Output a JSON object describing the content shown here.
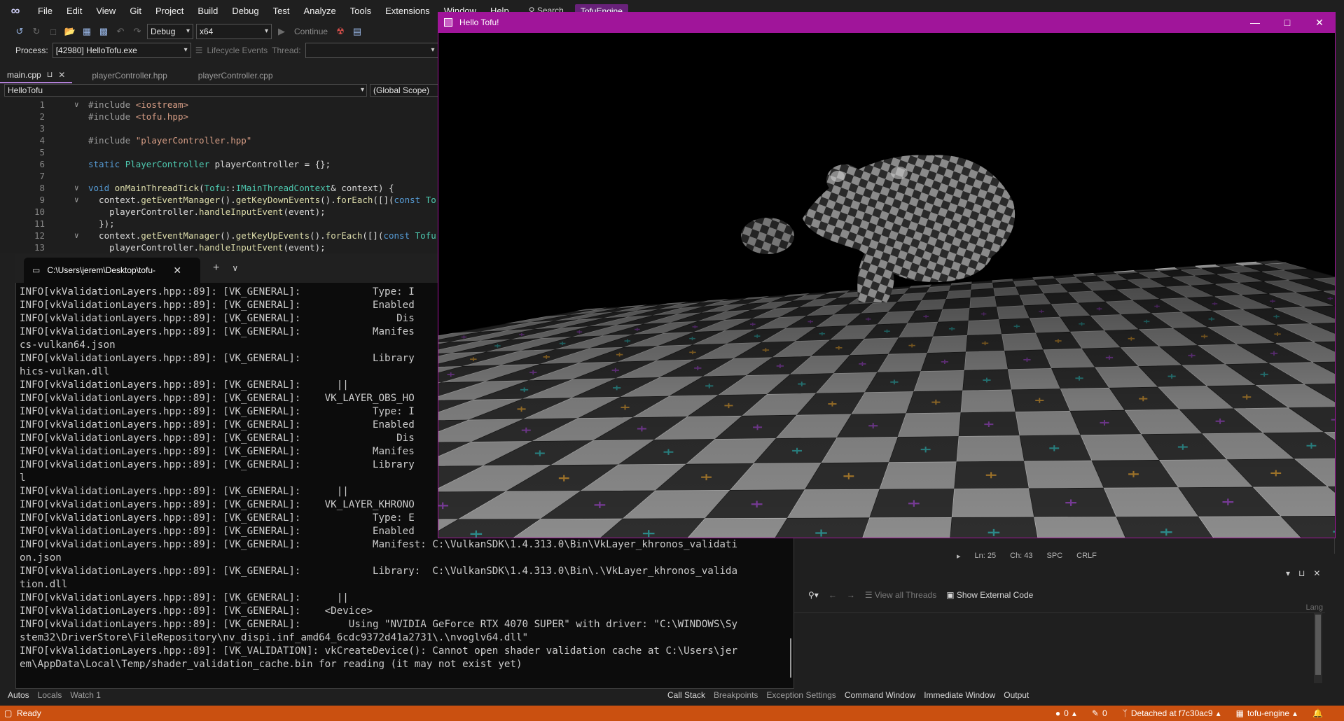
{
  "menubar": {
    "items": [
      "File",
      "Edit",
      "View",
      "Git",
      "Project",
      "Build",
      "Debug",
      "Test",
      "Analyze",
      "Tools",
      "Extensions",
      "Window",
      "Help"
    ],
    "search_label": "Search",
    "solution_name": "TofuEngine"
  },
  "toolbar": {
    "config": "Debug",
    "platform": "x64",
    "continue_label": "Continue"
  },
  "processbar": {
    "process_label": "Process:",
    "process_value": "[42980] HelloTofu.exe",
    "lifecycle_label": "Lifecycle Events",
    "thread_label": "Thread:"
  },
  "editor": {
    "tabs": [
      "main.cpp",
      "playerController.hpp",
      "playerController.cpp"
    ],
    "project_dropdown": "HelloTofu",
    "scope_dropdown": "(Global Scope)"
  },
  "statusline": {
    "ln": "Ln: 25",
    "ch": "Ch: 43",
    "spc": "SPC",
    "crlf": "CRLF"
  },
  "lower_panel": {
    "view_all_threads": "View all Threads",
    "show_external_code": "Show External Code",
    "lang_col": "Lang"
  },
  "bottom_tabs_left": [
    "Autos",
    "Locals",
    "Watch 1"
  ],
  "bottom_tabs_right": [
    "Call Stack",
    "Breakpoints",
    "Exception Settings",
    "Command Window",
    "Immediate Window",
    "Output"
  ],
  "statusbar": {
    "ready": "Ready",
    "errors": "0",
    "edits": "0",
    "git": "Detached at f7c30ac9",
    "repo": "tofu-engine"
  },
  "terminal": {
    "tab_title": "C:\\Users\\jerem\\Desktop\\tofu-",
    "lines": [
      "INFO[vkValidationLayers.hpp::89]: [VK_GENERAL]:            Type: I",
      "INFO[vkValidationLayers.hpp::89]: [VK_GENERAL]:            Enabled",
      "INFO[vkValidationLayers.hpp::89]: [VK_GENERAL]:                Dis",
      "INFO[vkValidationLayers.hpp::89]: [VK_GENERAL]:            Manifes",
      "cs-vulkan64.json",
      "INFO[vkValidationLayers.hpp::89]: [VK_GENERAL]:            Library",
      "hics-vulkan.dll",
      "INFO[vkValidationLayers.hpp::89]: [VK_GENERAL]:      ||",
      "INFO[vkValidationLayers.hpp::89]: [VK_GENERAL]:    VK_LAYER_OBS_HO",
      "INFO[vkValidationLayers.hpp::89]: [VK_GENERAL]:            Type: I",
      "INFO[vkValidationLayers.hpp::89]: [VK_GENERAL]:            Enabled",
      "INFO[vkValidationLayers.hpp::89]: [VK_GENERAL]:                Dis",
      "INFO[vkValidationLayers.hpp::89]: [VK_GENERAL]:            Manifes",
      "INFO[vkValidationLayers.hpp::89]: [VK_GENERAL]:            Library",
      "l",
      "INFO[vkValidationLayers.hpp::89]: [VK_GENERAL]:      ||",
      "INFO[vkValidationLayers.hpp::89]: [VK_GENERAL]:    VK_LAYER_KHRONO",
      "INFO[vkValidationLayers.hpp::89]: [VK_GENERAL]:            Type: E",
      "INFO[vkValidationLayers.hpp::89]: [VK_GENERAL]:            Enabled",
      "INFO[vkValidationLayers.hpp::89]: [VK_GENERAL]:            Manifest: C:\\VulkanSDK\\1.4.313.0\\Bin\\VkLayer_khronos_validati",
      "on.json",
      "INFO[vkValidationLayers.hpp::89]: [VK_GENERAL]:            Library:  C:\\VulkanSDK\\1.4.313.0\\Bin\\.\\VkLayer_khronos_valida",
      "tion.dll",
      "INFO[vkValidationLayers.hpp::89]: [VK_GENERAL]:      ||",
      "INFO[vkValidationLayers.hpp::89]: [VK_GENERAL]:    <Device>",
      "INFO[vkValidationLayers.hpp::89]: [VK_GENERAL]:        Using \"NVIDIA GeForce RTX 4070 SUPER\" with driver: \"C:\\WINDOWS\\Sy",
      "stem32\\DriverStore\\FileRepository\\nv_dispi.inf_amd64_6cdc9372d41a2731\\.\\nvoglv64.dll\"",
      "INFO[vkValidationLayers.hpp::89]: [VK_VALIDATION]: vkCreateDevice(): Cannot open shader validation cache at C:\\Users\\jer",
      "em\\AppData\\Local\\Temp/shader_validation_cache.bin for reading (it may not exist yet)"
    ]
  },
  "tofu_window": {
    "title": "Hello Tofu!"
  },
  "code": {
    "line_numbers": [
      "1",
      "2",
      "3",
      "4",
      "5",
      "6",
      "7",
      "8",
      "9",
      "10",
      "11",
      "12",
      "13"
    ]
  }
}
